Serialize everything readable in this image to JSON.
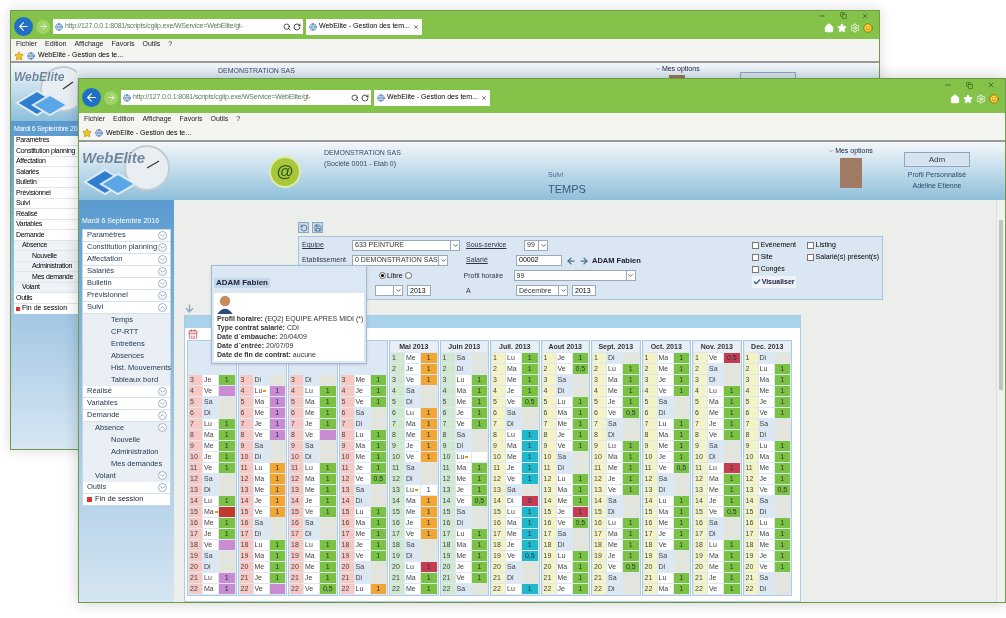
{
  "back_window": {
    "address": "http://127.0.0.1:8081/scripts/cgiip.exe/WService=WebElite/gt-",
    "tab": "WebElite - Gestion des tem...",
    "menu": [
      "Fichier",
      "Edition",
      "Affichage",
      "Favoris",
      "Outils",
      "?"
    ],
    "favorite": "WebElite - Gestion des te...",
    "logo": "WebElite",
    "company": "DEMONSTRATION SAS",
    "options": "Mes options",
    "date": "Mardi 6 Septembre 20",
    "nav": [
      {
        "label": "Paramètres",
        "kind": "menu"
      },
      {
        "label": "Constitution planning",
        "kind": "menu"
      },
      {
        "label": "Affectation",
        "kind": "menu"
      },
      {
        "label": "Salariés",
        "kind": "menu"
      },
      {
        "label": "Bulletin",
        "kind": "menu"
      },
      {
        "label": "Prévisionnel",
        "kind": "menu"
      },
      {
        "label": "Suivi",
        "kind": "menu"
      },
      {
        "label": "Réalisé",
        "kind": "menu"
      },
      {
        "label": "Variables",
        "kind": "menu"
      },
      {
        "label": "Demande",
        "kind": "menu",
        "children": [
          {
            "label": "Absence",
            "children": [
              {
                "label": "Nouvelle"
              },
              {
                "label": "Administration"
              },
              {
                "label": "Mes demande"
              }
            ]
          },
          {
            "label": "Volant"
          }
        ]
      },
      {
        "label": "Outils",
        "kind": "menu"
      },
      {
        "label": "Fin de session",
        "kind": "logout"
      }
    ]
  },
  "window": {
    "address": "http://127.0.0.1:8081/scripts/cgiip.exe/WService=WebElite/gt-",
    "tab": "WebElite - Gestion des tem...",
    "menu": [
      "Fichier",
      "Edition",
      "Affichage",
      "Favoris",
      "Outils",
      "?"
    ],
    "favorite": "WebElite - Gestion des te..."
  },
  "header": {
    "logo": "WebElite",
    "badge": "@",
    "company": "DEMONSTRATION SAS",
    "company_detail": "(Société 0001 - Etab 0)",
    "section": "Suivi",
    "page": "TEMPS",
    "options": "Mes options",
    "admin_button": "Adm",
    "profile": "Profil Personnalisé",
    "user": "Adeline Etienne"
  },
  "sidebar": {
    "date": "Mardi 6 Septembre 2016",
    "items": [
      {
        "label": "Paramètres",
        "kind": "menu",
        "expanded": false
      },
      {
        "label": "Constitution planning",
        "kind": "menu",
        "expanded": false
      },
      {
        "label": "Affectation",
        "kind": "menu",
        "expanded": false
      },
      {
        "label": "Salariés",
        "kind": "menu",
        "expanded": false
      },
      {
        "label": "Bulletin",
        "kind": "menu",
        "expanded": false
      },
      {
        "label": "Prévisionnel",
        "kind": "menu",
        "expanded": false
      },
      {
        "label": "Suivi",
        "kind": "menu",
        "expanded": true,
        "children": [
          {
            "label": "Temps"
          },
          {
            "label": "CP-RTT"
          },
          {
            "label": "Entretiens"
          },
          {
            "label": "Absences"
          },
          {
            "label": "Hist. Mouvements"
          },
          {
            "label": "Tableaux bord"
          }
        ]
      },
      {
        "label": "Réalisé",
        "kind": "menu",
        "expanded": false
      },
      {
        "label": "Variables",
        "kind": "menu",
        "expanded": false
      },
      {
        "label": "Demande",
        "kind": "menu",
        "expanded": true,
        "children": [
          {
            "label": "Absence",
            "expanded": true,
            "children": [
              {
                "label": "Nouvelle"
              },
              {
                "label": "Administration"
              },
              {
                "label": "Mes demandes"
              }
            ]
          },
          {
            "label": "Volant",
            "expanded": false
          }
        ]
      },
      {
        "label": "Outils",
        "kind": "menu",
        "expanded": false
      },
      {
        "label": "Fin de session",
        "kind": "logout"
      }
    ]
  },
  "form": {
    "team_label": "Equipe",
    "team": "633 PEINTURE",
    "subservice_label": "Sous-service",
    "subservice": "99",
    "establishment_label": "Etablissement",
    "establishment": "0 DEMONSTRATION SAS",
    "employee_label": "Salarié",
    "employee_id": "00002",
    "employee_name": "ADAM Fabien",
    "mode_options": [
      {
        "label": "Libre",
        "selected": true
      },
      {
        "selected": false
      }
    ],
    "profile_label": "Profil horaire",
    "profile": "99",
    "from_year": "2013",
    "to_label": "A",
    "to_month": "Décembre",
    "to_year": "2013",
    "checkboxes": [
      {
        "label": "Evénement",
        "checked": false
      },
      {
        "label": "Listing",
        "checked": false
      },
      {
        "label": "Site",
        "checked": false
      },
      {
        "label": "Salarié(s) présent(s)",
        "checked": false
      },
      {
        "label": "Congés",
        "checked": false
      }
    ],
    "submit": "Visualiser"
  },
  "tooltip": {
    "name": "ADAM Fabien",
    "details": [
      {
        "label": "Profil horaire:",
        "value": "(EQ2) EQUIPE APRES MIDI (*)"
      },
      {
        "label": "Type contrat salarié:",
        "value": "CDI"
      },
      {
        "label": "Date d´embauche:",
        "value": "20/04/09"
      },
      {
        "label": "Date d´entrée:",
        "value": "20/07/09"
      },
      {
        "label": "Date de fin de contrat:",
        "value": "aucune"
      }
    ]
  },
  "calendar": {
    "months": [
      {
        "color": "#f8c9c4",
        "rows": [
          {
            "day": "3",
            "weekday": "Je",
            "value": "1",
            "color": "#7cc242"
          },
          {
            "day": "4",
            "weekday": "Ve",
            "color": "#c98bd2"
          },
          {
            "day": "5",
            "weekday": "Sa"
          },
          {
            "day": "6",
            "weekday": "Di"
          },
          {
            "day": "7",
            "weekday": "Lu",
            "value": "1",
            "color": "#7cc242"
          },
          {
            "day": "8",
            "weekday": "Ma",
            "value": "1",
            "color": "#7cc242"
          },
          {
            "day": "9",
            "weekday": "Me",
            "value": "1",
            "color": "#7cc242"
          },
          {
            "day": "10",
            "weekday": "Je",
            "value": "1",
            "color": "#7cc242"
          },
          {
            "day": "11",
            "weekday": "Ve",
            "value": "1",
            "color": "#7cc242"
          },
          {
            "day": "12",
            "weekday": "Sa"
          },
          {
            "day": "13",
            "weekday": "Di"
          },
          {
            "day": "14",
            "weekday": "Lu",
            "value": "1",
            "color": "#7cc242"
          },
          {
            "day": "15",
            "weekday": "Ma",
            "flag": true,
            "color": "#c0392b"
          },
          {
            "day": "16",
            "weekday": "Me",
            "value": "1",
            "color": "#7cc242"
          },
          {
            "day": "17",
            "weekday": "Je",
            "value": "1",
            "color": "#7cc242"
          },
          {
            "day": "18",
            "weekday": "Ve",
            "color": "#c98bd2"
          },
          {
            "day": "19",
            "weekday": "Sa"
          },
          {
            "day": "20",
            "weekday": "Di"
          },
          {
            "day": "21",
            "weekday": "Lu",
            "value": "1",
            "color": "#c98bd2"
          },
          {
            "day": "22",
            "weekday": "Ma",
            "value": "1",
            "color": "#c98bd2"
          }
        ]
      },
      {
        "color": "#f8c9c4",
        "rows": [
          {
            "day": "3",
            "weekday": "Di"
          },
          {
            "day": "4",
            "weekday": "Lu",
            "flag": true,
            "value": "1",
            "color": "#c98bd2"
          },
          {
            "day": "5",
            "weekday": "Ma",
            "value": "1",
            "color": "#c98bd2"
          },
          {
            "day": "6",
            "weekday": "Me",
            "value": "1",
            "color": "#c98bd2"
          },
          {
            "day": "7",
            "weekday": "Je",
            "value": "1",
            "color": "#c98bd2"
          },
          {
            "day": "8",
            "weekday": "Ve",
            "value": "1",
            "color": "#c98bd2"
          },
          {
            "day": "9",
            "weekday": "Sa"
          },
          {
            "day": "10",
            "weekday": "Di"
          },
          {
            "day": "11",
            "weekday": "Lu",
            "value": "1",
            "color": "#f2a735"
          },
          {
            "day": "12",
            "weekday": "Ma",
            "value": "1",
            "color": "#f2a735"
          },
          {
            "day": "13",
            "weekday": "Me",
            "value": "1",
            "color": "#f2a735"
          },
          {
            "day": "14",
            "weekday": "Je",
            "value": "1",
            "color": "#f2a735"
          },
          {
            "day": "15",
            "weekday": "Ve",
            "value": "1",
            "color": "#f2a735"
          },
          {
            "day": "16",
            "weekday": "Sa"
          },
          {
            "day": "17",
            "weekday": "Di"
          },
          {
            "day": "18",
            "weekday": "Lu",
            "value": "1",
            "color": "#7cc242"
          },
          {
            "day": "19",
            "weekday": "Ma",
            "value": "1",
            "color": "#7cc242"
          },
          {
            "day": "20",
            "weekday": "Me",
            "value": "1",
            "color": "#7cc242"
          },
          {
            "day": "21",
            "weekday": "Je",
            "value": "1",
            "color": "#7cc242"
          },
          {
            "day": "22",
            "weekday": "Ve",
            "color": "#c98bd2"
          }
        ]
      },
      {
        "color": "#f8c9c4",
        "rows": [
          {
            "day": "3",
            "weekday": "Di"
          },
          {
            "day": "4",
            "weekday": "Lu",
            "value": "1",
            "color": "#7cc242"
          },
          {
            "day": "5",
            "weekday": "Ma",
            "value": "1",
            "color": "#7cc242"
          },
          {
            "day": "6",
            "weekday": "Me",
            "value": "1",
            "color": "#7cc242"
          },
          {
            "day": "7",
            "weekday": "Je",
            "value": "1",
            "color": "#7cc242"
          },
          {
            "day": "8",
            "weekday": "Ve",
            "color": "#c98bd2"
          },
          {
            "day": "9",
            "weekday": "Sa"
          },
          {
            "day": "10",
            "weekday": "Di"
          },
          {
            "day": "11",
            "weekday": "Lu",
            "value": "1",
            "color": "#7cc242"
          },
          {
            "day": "12",
            "weekday": "Ma",
            "value": "1",
            "color": "#7cc242"
          },
          {
            "day": "13",
            "weekday": "Me",
            "value": "1",
            "color": "#7cc242"
          },
          {
            "day": "14",
            "weekday": "Je",
            "value": "1",
            "color": "#7cc242"
          },
          {
            "day": "15",
            "weekday": "Ve",
            "value": "1",
            "color": "#7cc242"
          },
          {
            "day": "16",
            "weekday": "Sa"
          },
          {
            "day": "17",
            "weekday": "Di"
          },
          {
            "day": "18",
            "weekday": "Lu",
            "value": "1",
            "color": "#7cc242"
          },
          {
            "day": "19",
            "weekday": "Ma",
            "value": "1",
            "color": "#7cc242"
          },
          {
            "day": "20",
            "weekday": "Me",
            "value": "1",
            "color": "#7cc242"
          },
          {
            "day": "21",
            "weekday": "Je",
            "value": "1",
            "color": "#7cc242"
          },
          {
            "day": "22",
            "weekday": "Ve",
            "value": "0,5",
            "color": "#7cc242"
          }
        ]
      },
      {
        "color": "#f8c9c4",
        "rows": [
          {
            "day": "3",
            "weekday": "Me",
            "value": "1",
            "color": "#7cc242"
          },
          {
            "day": "4",
            "weekday": "Je",
            "value": "1",
            "color": "#7cc242"
          },
          {
            "day": "5",
            "weekday": "Ve",
            "value": "1",
            "color": "#7cc242"
          },
          {
            "day": "6",
            "weekday": "Sa"
          },
          {
            "day": "7",
            "weekday": "Di"
          },
          {
            "day": "8",
            "weekday": "Lu",
            "value": "1",
            "color": "#7cc242"
          },
          {
            "day": "9",
            "weekday": "Ma",
            "value": "1",
            "color": "#7cc242"
          },
          {
            "day": "10",
            "weekday": "Me",
            "value": "1",
            "color": "#7cc242"
          },
          {
            "day": "11",
            "weekday": "Je",
            "value": "1",
            "color": "#7cc242"
          },
          {
            "day": "12",
            "weekday": "Ve",
            "value": "0,5",
            "color": "#7cc242"
          },
          {
            "day": "13",
            "weekday": "Sa"
          },
          {
            "day": "14",
            "weekday": "Di"
          },
          {
            "day": "15",
            "weekday": "Lu",
            "value": "1",
            "color": "#7cc242"
          },
          {
            "day": "16",
            "weekday": "Ma",
            "value": "1",
            "color": "#7cc242"
          },
          {
            "day": "17",
            "weekday": "Me",
            "value": "1",
            "color": "#7cc242"
          },
          {
            "day": "18",
            "weekday": "Je",
            "value": "1",
            "color": "#7cc242"
          },
          {
            "day": "19",
            "weekday": "Ve",
            "value": "1",
            "color": "#7cc242"
          },
          {
            "day": "20",
            "weekday": "Sa"
          },
          {
            "day": "21",
            "weekday": "Di"
          },
          {
            "day": "22",
            "weekday": "Lu",
            "value": "1",
            "color": "#f2a735"
          }
        ]
      },
      {
        "title": "Mai 2013",
        "color": "#cfe8cf",
        "rows": [
          {
            "day": "1",
            "weekday": "Me",
            "value": "1",
            "color": "#f2a735"
          },
          {
            "day": "2",
            "weekday": "Je",
            "value": "1",
            "color": "#f2a735"
          },
          {
            "day": "3",
            "weekday": "Ve",
            "value": "1",
            "color": "#f2a735"
          },
          {
            "day": "4",
            "weekday": "Sa"
          },
          {
            "day": "5",
            "weekday": "Di"
          },
          {
            "day": "6",
            "weekday": "Lu",
            "value": "1",
            "color": "#f2a735"
          },
          {
            "day": "7",
            "weekday": "Ma",
            "value": "1",
            "color": "#f2a735"
          },
          {
            "day": "8",
            "weekday": "Me",
            "value": "1",
            "color": "#f2a735"
          },
          {
            "day": "9",
            "weekday": "Je",
            "value": "1",
            "color": "#f2a735"
          },
          {
            "day": "10",
            "weekday": "Ve",
            "value": "1",
            "color": "#f2a735"
          },
          {
            "day": "11",
            "weekday": "Sa"
          },
          {
            "day": "12",
            "weekday": "Di"
          },
          {
            "day": "13",
            "weekday": "Lu",
            "flag": true,
            "value": "1",
            "color": "#ffffff"
          },
          {
            "day": "14",
            "weekday": "Ma",
            "value": "1",
            "color": "#f2a735"
          },
          {
            "day": "15",
            "weekday": "Me",
            "value": "1",
            "color": "#f2a735"
          },
          {
            "day": "16",
            "weekday": "Je",
            "value": "1",
            "color": "#f2a735"
          },
          {
            "day": "17",
            "weekday": "Ve",
            "value": "1",
            "color": "#f2a735"
          },
          {
            "day": "18",
            "weekday": "Sa"
          },
          {
            "day": "19",
            "weekday": "Di"
          },
          {
            "day": "20",
            "weekday": "Lu",
            "value": "1",
            "color": "#c43d52"
          },
          {
            "day": "21",
            "weekday": "Ma",
            "value": "1",
            "color": "#7cc242"
          },
          {
            "day": "22",
            "weekday": "Me",
            "value": "1",
            "color": "#7cc242"
          }
        ]
      },
      {
        "title": "Juin 2013",
        "color": "#cfe8cf",
        "rows": [
          {
            "day": "1",
            "weekday": "Sa"
          },
          {
            "day": "2",
            "weekday": "Di"
          },
          {
            "day": "3",
            "weekday": "Lu",
            "value": "1",
            "color": "#7cc242"
          },
          {
            "day": "4",
            "weekday": "Ma",
            "value": "1",
            "color": "#7cc242"
          },
          {
            "day": "5",
            "weekday": "Me",
            "value": "1",
            "color": "#7cc242"
          },
          {
            "day": "6",
            "weekday": "Je",
            "value": "1",
            "color": "#7cc242"
          },
          {
            "day": "7",
            "weekday": "Ve",
            "value": "1",
            "color": "#7cc242"
          },
          {
            "day": "8",
            "weekday": "Sa"
          },
          {
            "day": "9",
            "weekday": "Di"
          },
          {
            "day": "10",
            "weekday": "Lu",
            "flag": true,
            "color": "#ffffff"
          },
          {
            "day": "11",
            "weekday": "Ma",
            "value": "1",
            "color": "#7cc242"
          },
          {
            "day": "12",
            "weekday": "Me",
            "value": "1",
            "color": "#7cc242"
          },
          {
            "day": "13",
            "weekday": "Je",
            "value": "1",
            "color": "#7cc242"
          },
          {
            "day": "14",
            "weekday": "Ve",
            "value": "0,5",
            "color": "#7cc242"
          },
          {
            "day": "15",
            "weekday": "Sa"
          },
          {
            "day": "16",
            "weekday": "Di"
          },
          {
            "day": "17",
            "weekday": "Lu",
            "value": "1",
            "color": "#7cc242"
          },
          {
            "day": "18",
            "weekday": "Ma",
            "value": "1",
            "color": "#7cc242"
          },
          {
            "day": "19",
            "weekday": "Me",
            "value": "1",
            "color": "#7cc242"
          },
          {
            "day": "20",
            "weekday": "Je",
            "value": "1",
            "color": "#7cc242"
          },
          {
            "day": "21",
            "weekday": "Ve",
            "value": "1",
            "color": "#7cc242"
          },
          {
            "day": "22",
            "weekday": "Sa"
          }
        ]
      },
      {
        "title": "Juil. 2013",
        "color": "#f3f3c6",
        "rows": [
          {
            "day": "1",
            "weekday": "Lu",
            "value": "1",
            "color": "#7cc242"
          },
          {
            "day": "2",
            "weekday": "Ma",
            "value": "1",
            "color": "#7cc242"
          },
          {
            "day": "3",
            "weekday": "Me",
            "value": "1",
            "color": "#7cc242"
          },
          {
            "day": "4",
            "weekday": "Je",
            "value": "1",
            "color": "#7cc242"
          },
          {
            "day": "5",
            "weekday": "Ve",
            "value": "0,5",
            "color": "#7cc242"
          },
          {
            "day": "6",
            "weekday": "Sa"
          },
          {
            "day": "7",
            "weekday": "Di"
          },
          {
            "day": "8",
            "weekday": "Lu",
            "value": "1",
            "color": "#22b8cc"
          },
          {
            "day": "9",
            "weekday": "Ma",
            "value": "1",
            "color": "#22b8cc"
          },
          {
            "day": "10",
            "weekday": "Me",
            "value": "1",
            "color": "#22b8cc"
          },
          {
            "day": "11",
            "weekday": "Je",
            "value": "1",
            "color": "#22b8cc"
          },
          {
            "day": "12",
            "weekday": "Ve",
            "value": "1",
            "color": "#22b8cc"
          },
          {
            "day": "13",
            "weekday": "Sa"
          },
          {
            "day": "14",
            "weekday": "Di",
            "value": "0",
            "color": "#c43d52"
          },
          {
            "day": "15",
            "weekday": "Lu",
            "value": "1",
            "color": "#22b8cc"
          },
          {
            "day": "16",
            "weekday": "Ma",
            "value": "1",
            "color": "#22b8cc"
          },
          {
            "day": "17",
            "weekday": "Me",
            "value": "1",
            "color": "#22b8cc"
          },
          {
            "day": "18",
            "weekday": "Je",
            "value": "1",
            "color": "#22b8cc"
          },
          {
            "day": "19",
            "weekday": "Ve",
            "value": "0,5",
            "color": "#22b8cc"
          },
          {
            "day": "20",
            "weekday": "Sa"
          },
          {
            "day": "21",
            "weekday": "Di"
          },
          {
            "day": "22",
            "weekday": "Lu",
            "value": "1",
            "color": "#22b8cc"
          }
        ]
      },
      {
        "title": "Aout 2013",
        "color": "#f3f3c6",
        "rows": [
          {
            "day": "1",
            "weekday": "Je",
            "value": "1",
            "color": "#7cc242"
          },
          {
            "day": "2",
            "weekday": "Ve",
            "value": "0,5",
            "color": "#7cc242"
          },
          {
            "day": "3",
            "weekday": "Sa"
          },
          {
            "day": "4",
            "weekday": "Di"
          },
          {
            "day": "5",
            "weekday": "Lu",
            "value": "1",
            "color": "#7cc242"
          },
          {
            "day": "6",
            "weekday": "Ma",
            "value": "1",
            "color": "#7cc242"
          },
          {
            "day": "7",
            "weekday": "Me",
            "value": "1",
            "color": "#7cc242"
          },
          {
            "day": "8",
            "weekday": "Je",
            "value": "1",
            "color": "#7cc242"
          },
          {
            "day": "9",
            "weekday": "Ve",
            "value": "1",
            "color": "#7cc242"
          },
          {
            "day": "10",
            "weekday": "Sa"
          },
          {
            "day": "11",
            "weekday": "Di"
          },
          {
            "day": "12",
            "weekday": "Lu",
            "value": "1",
            "color": "#7cc242"
          },
          {
            "day": "13",
            "weekday": "Ma",
            "value": "1",
            "color": "#7cc242"
          },
          {
            "day": "14",
            "weekday": "Me",
            "value": "1",
            "color": "#7cc242"
          },
          {
            "day": "15",
            "weekday": "Je",
            "value": "1",
            "color": "#c43d52"
          },
          {
            "day": "16",
            "weekday": "Ve",
            "value": "0,5",
            "color": "#7cc242"
          },
          {
            "day": "17",
            "weekday": "Sa"
          },
          {
            "day": "18",
            "weekday": "Di"
          },
          {
            "day": "19",
            "weekday": "Lu",
            "value": "1",
            "color": "#7cc242"
          },
          {
            "day": "20",
            "weekday": "Ma",
            "value": "1",
            "color": "#7cc242"
          },
          {
            "day": "21",
            "weekday": "Me",
            "value": "1",
            "color": "#7cc242"
          },
          {
            "day": "22",
            "weekday": "Je",
            "value": "1",
            "color": "#7cc242"
          }
        ]
      },
      {
        "title": "Sept. 2013",
        "color": "#f3f3c6",
        "rows": [
          {
            "day": "1",
            "weekday": "Di"
          },
          {
            "day": "2",
            "weekday": "Lu",
            "value": "1",
            "color": "#7cc242"
          },
          {
            "day": "3",
            "weekday": "Ma",
            "value": "1",
            "color": "#7cc242"
          },
          {
            "day": "4",
            "weekday": "Me",
            "value": "1",
            "color": "#7cc242"
          },
          {
            "day": "5",
            "weekday": "Je",
            "value": "1",
            "color": "#7cc242"
          },
          {
            "day": "6",
            "weekday": "Ve",
            "value": "0,5",
            "color": "#7cc242"
          },
          {
            "day": "7",
            "weekday": "Sa"
          },
          {
            "day": "8",
            "weekday": "Di"
          },
          {
            "day": "9",
            "weekday": "Lu",
            "value": "1",
            "color": "#7cc242"
          },
          {
            "day": "10",
            "weekday": "Ma",
            "value": "1",
            "color": "#7cc242"
          },
          {
            "day": "11",
            "weekday": "Me",
            "value": "1",
            "color": "#7cc242"
          },
          {
            "day": "12",
            "weekday": "Je",
            "value": "1",
            "color": "#7cc242"
          },
          {
            "day": "13",
            "weekday": "Ve",
            "value": "1",
            "color": "#7cc242"
          },
          {
            "day": "14",
            "weekday": "Sa"
          },
          {
            "day": "15",
            "weekday": "Di"
          },
          {
            "day": "16",
            "weekday": "Lu",
            "value": "1",
            "color": "#7cc242"
          },
          {
            "day": "17",
            "weekday": "Ma",
            "value": "1",
            "color": "#7cc242"
          },
          {
            "day": "18",
            "weekday": "Me",
            "value": "1",
            "color": "#7cc242"
          },
          {
            "day": "19",
            "weekday": "Je",
            "value": "1",
            "color": "#7cc242"
          },
          {
            "day": "20",
            "weekday": "Ve",
            "value": "0,5",
            "color": "#7cc242"
          },
          {
            "day": "21",
            "weekday": "Sa"
          },
          {
            "day": "22",
            "weekday": "Di"
          }
        ]
      },
      {
        "title": "Oct. 2013",
        "color": "#f3f3c6",
        "rows": [
          {
            "day": "1",
            "weekday": "Ma",
            "value": "1",
            "color": "#7cc242"
          },
          {
            "day": "2",
            "weekday": "Me",
            "value": "1",
            "color": "#7cc242"
          },
          {
            "day": "3",
            "weekday": "Je",
            "value": "1",
            "color": "#7cc242"
          },
          {
            "day": "4",
            "weekday": "Ve",
            "value": "1",
            "color": "#7cc242"
          },
          {
            "day": "5",
            "weekday": "Sa"
          },
          {
            "day": "6",
            "weekday": "Di"
          },
          {
            "day": "7",
            "weekday": "Lu",
            "value": "1",
            "color": "#7cc242"
          },
          {
            "day": "8",
            "weekday": "Ma",
            "value": "1",
            "color": "#7cc242"
          },
          {
            "day": "9",
            "weekday": "Me",
            "value": "1",
            "color": "#7cc242"
          },
          {
            "day": "10",
            "weekday": "Je",
            "value": "1",
            "color": "#7cc242"
          },
          {
            "day": "11",
            "weekday": "Ve",
            "value": "0,5",
            "color": "#7cc242"
          },
          {
            "day": "12",
            "weekday": "Sa"
          },
          {
            "day": "13",
            "weekday": "Di"
          },
          {
            "day": "14",
            "weekday": "Lu",
            "value": "1",
            "color": "#7cc242"
          },
          {
            "day": "15",
            "weekday": "Ma",
            "value": "1",
            "color": "#7cc242"
          },
          {
            "day": "16",
            "weekday": "Me",
            "value": "1",
            "color": "#7cc242"
          },
          {
            "day": "17",
            "weekday": "Je",
            "value": "1",
            "color": "#7cc242"
          },
          {
            "day": "18",
            "weekday": "Ve",
            "value": "1",
            "color": "#7cc242"
          },
          {
            "day": "19",
            "weekday": "Sa"
          },
          {
            "day": "20",
            "weekday": "Di"
          },
          {
            "day": "21",
            "weekday": "Lu",
            "value": "1",
            "color": "#7cc242"
          },
          {
            "day": "22",
            "weekday": "Ma",
            "value": "1",
            "color": "#7cc242"
          }
        ]
      },
      {
        "title": "Nov. 2013",
        "color": "#f3f3c6",
        "rows": [
          {
            "day": "1",
            "weekday": "Ve",
            "value": "0,5",
            "color": "#c43d52"
          },
          {
            "day": "2",
            "weekday": "Sa"
          },
          {
            "day": "3",
            "weekday": "Di"
          },
          {
            "day": "4",
            "weekday": "Lu",
            "value": "1",
            "color": "#7cc242"
          },
          {
            "day": "5",
            "weekday": "Ma",
            "value": "1",
            "color": "#7cc242"
          },
          {
            "day": "6",
            "weekday": "Me",
            "value": "1",
            "color": "#7cc242"
          },
          {
            "day": "7",
            "weekday": "Je",
            "value": "1",
            "color": "#7cc242"
          },
          {
            "day": "8",
            "weekday": "Ve",
            "value": "1",
            "color": "#7cc242"
          },
          {
            "day": "9",
            "weekday": "Sa"
          },
          {
            "day": "10",
            "weekday": "Di"
          },
          {
            "day": "11",
            "weekday": "Lu",
            "value": "1",
            "color": "#c43d52"
          },
          {
            "day": "12",
            "weekday": "Ma",
            "value": "1",
            "color": "#7cc242"
          },
          {
            "day": "13",
            "weekday": "Me",
            "value": "1",
            "color": "#7cc242"
          },
          {
            "day": "14",
            "weekday": "Je",
            "value": "1",
            "color": "#7cc242"
          },
          {
            "day": "15",
            "weekday": "Ve",
            "value": "0,5",
            "color": "#7cc242"
          },
          {
            "day": "16",
            "weekday": "Sa"
          },
          {
            "day": "17",
            "weekday": "Di"
          },
          {
            "day": "18",
            "weekday": "Lu",
            "value": "1",
            "color": "#7cc242"
          },
          {
            "day": "19",
            "weekday": "Ma",
            "value": "1",
            "color": "#7cc242"
          },
          {
            "day": "20",
            "weekday": "Me",
            "value": "1",
            "color": "#7cc242"
          },
          {
            "day": "21",
            "weekday": "Je",
            "value": "1",
            "color": "#7cc242"
          },
          {
            "day": "22",
            "weekday": "Ve",
            "value": "1",
            "color": "#7cc242"
          }
        ]
      },
      {
        "title": "Dec. 2013",
        "color": "#f3f3c6",
        "rows": [
          {
            "day": "1",
            "weekday": "Di"
          },
          {
            "day": "2",
            "weekday": "Lu",
            "value": "1",
            "color": "#7cc242"
          },
          {
            "day": "3",
            "weekday": "Ma",
            "value": "1",
            "color": "#7cc242"
          },
          {
            "day": "4",
            "weekday": "Me",
            "value": "1",
            "color": "#7cc242"
          },
          {
            "day": "5",
            "weekday": "Je",
            "value": "1",
            "color": "#7cc242"
          },
          {
            "day": "6",
            "weekday": "Ve",
            "value": "1",
            "color": "#7cc242"
          },
          {
            "day": "7",
            "weekday": "Sa"
          },
          {
            "day": "8",
            "weekday": "Di"
          },
          {
            "day": "9",
            "weekday": "Lu",
            "value": "1",
            "color": "#7cc242"
          },
          {
            "day": "10",
            "weekday": "Ma",
            "value": "1",
            "color": "#7cc242"
          },
          {
            "day": "11",
            "weekday": "Me",
            "value": "1",
            "color": "#7cc242"
          },
          {
            "day": "12",
            "weekday": "Je",
            "value": "1",
            "color": "#7cc242"
          },
          {
            "day": "13",
            "weekday": "Ve",
            "value": "0,5",
            "color": "#7cc242"
          },
          {
            "day": "14",
            "weekday": "Sa"
          },
          {
            "day": "15",
            "weekday": "Di"
          },
          {
            "day": "16",
            "weekday": "Lu",
            "value": "1",
            "color": "#7cc242"
          },
          {
            "day": "17",
            "weekday": "Ma",
            "value": "1",
            "color": "#7cc242"
          },
          {
            "day": "18",
            "weekday": "Me",
            "value": "1",
            "color": "#7cc242"
          },
          {
            "day": "19",
            "weekday": "Je",
            "value": "1",
            "color": "#7cc242"
          },
          {
            "day": "20",
            "weekday": "Ve",
            "value": "1",
            "color": "#7cc242"
          },
          {
            "day": "21",
            "weekday": "Sa"
          },
          {
            "day": "22",
            "weekday": "Di"
          }
        ]
      }
    ]
  }
}
